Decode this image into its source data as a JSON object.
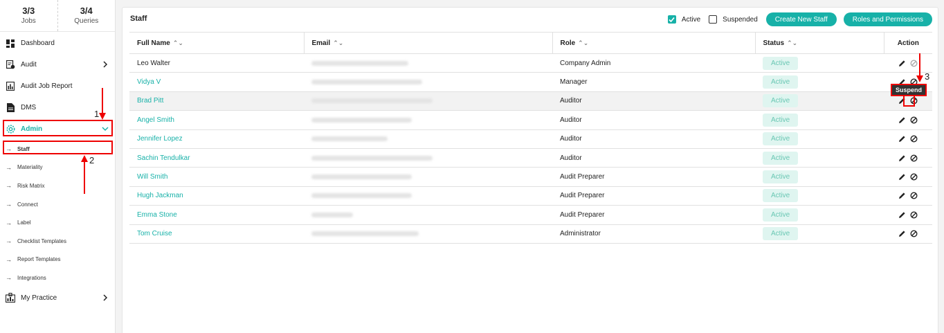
{
  "stats": {
    "jobs": {
      "value": "3/3",
      "label": "Jobs"
    },
    "queries": {
      "value": "3/4",
      "label": "Queries"
    }
  },
  "sidebar": {
    "items": [
      {
        "label": "Dashboard",
        "icon": "dashboard-icon"
      },
      {
        "label": "Audit",
        "icon": "audit-icon"
      },
      {
        "label": "Audit Job Report",
        "icon": "report-icon"
      },
      {
        "label": "DMS",
        "icon": "document-icon"
      },
      {
        "label": "Admin",
        "icon": "gear-icon"
      }
    ],
    "sub_items": [
      "Staff",
      "Materiality",
      "Risk Matrix",
      "Connect",
      "Label",
      "Checklist Templates",
      "Report Templates",
      "Integrations"
    ],
    "practice": {
      "label": "My Practice",
      "icon": "practice-icon"
    }
  },
  "page": {
    "title": "Staff",
    "filter_active": "Active",
    "filter_suspended": "Suspended",
    "create_button": "Create New Staff",
    "roles_button": "Roles and Permissions"
  },
  "table": {
    "headers": [
      "Full Name",
      "Email",
      "Role",
      "Status",
      "Action"
    ],
    "rows": [
      {
        "name": "Leo Walter",
        "email_visible": "",
        "role": "Company Admin",
        "status": "Active"
      },
      {
        "name": "Vidya V",
        "email_visible": "",
        "role": "Manager",
        "status": "Active"
      },
      {
        "name": "Brad Pitt",
        "email_visible": "",
        "role": "Auditor",
        "status": "Active"
      },
      {
        "name": "Angel Smith",
        "email_visible": "",
        "role": "Auditor",
        "status": "Active"
      },
      {
        "name": "Jennifer Lopez",
        "email_visible": "",
        "role": "Auditor",
        "status": "Active"
      },
      {
        "name": "Sachin Tendulkar",
        "email_visible": "",
        "role": "Auditor",
        "status": "Active"
      },
      {
        "name": "Will Smith",
        "email_visible": "",
        "role": "Audit Preparer",
        "status": "Active"
      },
      {
        "name": "Hugh Jackman",
        "email_visible": "",
        "role": "Audit Preparer",
        "status": "Active"
      },
      {
        "name": "Emma Stone",
        "email_visible": "",
        "role": "Audit Preparer",
        "status": "Active"
      },
      {
        "name": "Tom Cruise",
        "email_visible": "",
        "role": "Administrator",
        "status": "Active"
      }
    ]
  },
  "annotations": {
    "step1": "1",
    "step2": "2",
    "step3": "3",
    "tooltip": "Suspend"
  },
  "colors": {
    "accent": "#17b1a8",
    "badge_bg": "#dff5f0",
    "annotation": "#e00000"
  }
}
